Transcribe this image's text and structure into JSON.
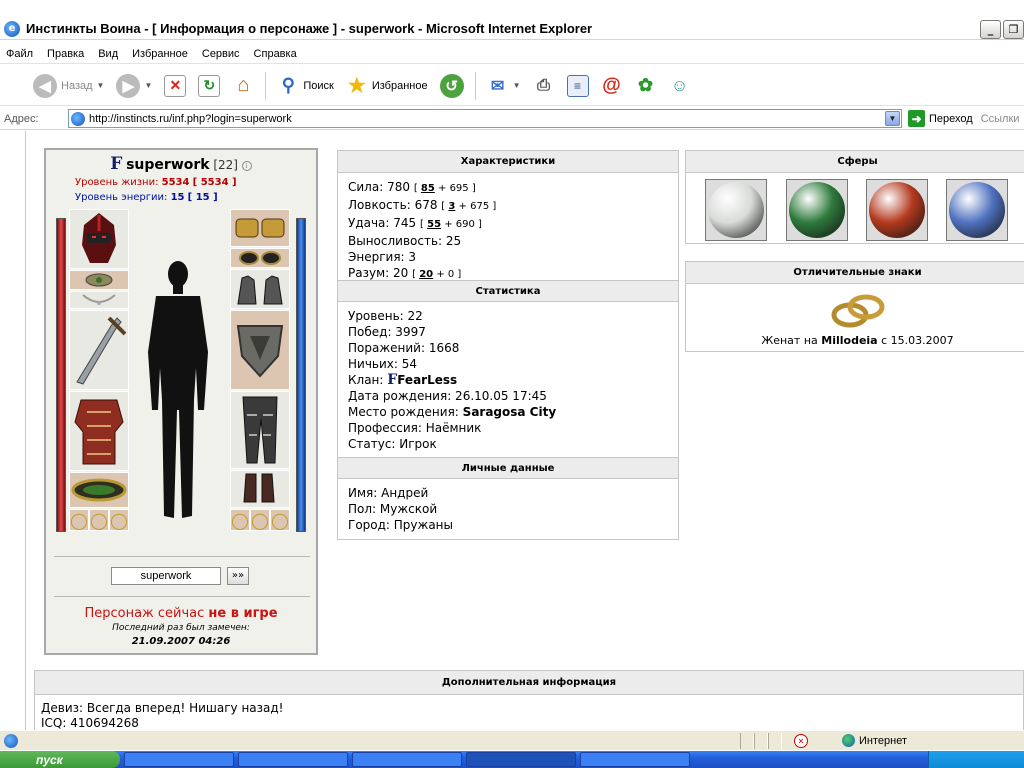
{
  "window": {
    "title": "Инстинкты Воина - [ Информация о персонаже ] - superwork - Microsoft Internet Explorer",
    "minimize": "_",
    "maximize": "❐"
  },
  "menu": [
    "Файл",
    "Правка",
    "Вид",
    "Избранное",
    "Сервис",
    "Справка"
  ],
  "toolbar": {
    "back": "Назад",
    "search": "Поиск",
    "favorites": "Избранное"
  },
  "address": {
    "label": "Адрес:",
    "url": "http://instincts.ru/inf.php?login=superwork",
    "go": "Переход",
    "links": "Ссылки"
  },
  "character": {
    "clan_glyph": "F",
    "name": "superwork",
    "level": "[22]",
    "hp_label": "Уровень жизни:",
    "hp_value": "5534",
    "hp_max": "[ 5534 ]",
    "energy_label": "Уровень энергии:",
    "energy_value": "15",
    "energy_max": "[ 15 ]",
    "lookup_value": "superwork",
    "lookup_button": "»»",
    "status_prefix": "Персонаж сейчас",
    "status_value": "не в игре",
    "last_seen_label": "Последний раз был замечен:",
    "last_seen_date": "21.09.2007 04:26"
  },
  "characteristics": {
    "header": "Характеристики",
    "strength_label": "Сила:",
    "strength_total": "780",
    "strength_bonus": "85",
    "strength_base": "+ 695",
    "agility_label": "Ловкость:",
    "agility_total": "678",
    "agility_bonus": "3",
    "agility_base": "+ 675",
    "luck_label": "Удача:",
    "luck_total": "745",
    "luck_bonus": "55",
    "luck_base": "+ 690",
    "stamina": "Выносливость: 25",
    "energy": "Энергия: 3",
    "mind_label": "Разум:",
    "mind_total": "20",
    "mind_bonus": "20",
    "mind_base": "+ 0"
  },
  "statistics": {
    "header": "Статистика",
    "level": "Уровень: 22",
    "wins": "Побед: 3997",
    "losses": "Поражений: 1668",
    "draws": "Ничьих: 54",
    "clan_label": "Клан:",
    "clan_glyph": "F",
    "clan_name": "FearLess",
    "birth": "Дата рождения: 26.10.05 17:45",
    "birthplace_label": "Место рождения:",
    "birthplace": "Saragosa City",
    "profession": "Профессия: Наёмник",
    "status": "Статус: Игрок"
  },
  "personal": {
    "header": "Личные данные",
    "name": "Имя: Андрей",
    "sex": "Пол: Мужской",
    "city": "Город: Пружаны"
  },
  "spheres": {
    "header": "Сферы",
    "colors": [
      "#d8dbd8",
      "#2f7a3c",
      "#b33a1f",
      "#5072c0"
    ]
  },
  "signs": {
    "header": "Отличительные знаки",
    "married_prefix": "Женат на",
    "spouse": "Millodeia",
    "married_suffix": "с 15.03.2007"
  },
  "extra": {
    "header": "Дополнительная информация",
    "motto": "Девиз: Всегда вперед! Нишагу назад!",
    "icq": "ICQ: 410694268"
  },
  "statusbar": {
    "zone": "Интернет"
  },
  "taskbar": {
    "start": "пуск"
  }
}
